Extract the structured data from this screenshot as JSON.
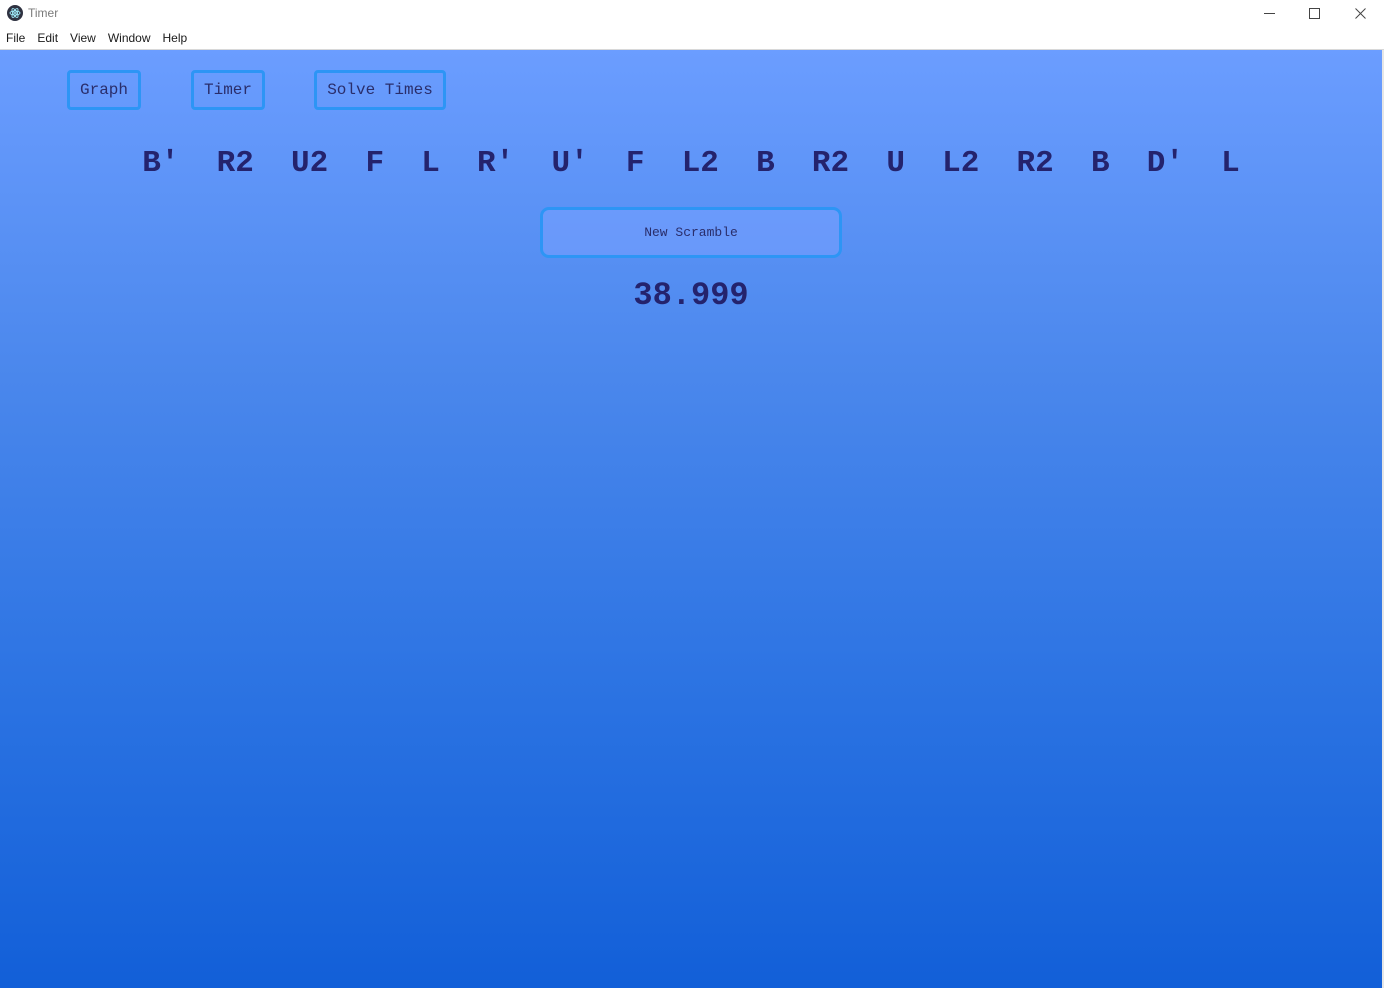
{
  "window": {
    "title": "Timer",
    "app_icon": "electron-atom-icon",
    "controls": [
      "minimize-icon",
      "maximize-icon",
      "close-icon"
    ]
  },
  "menubar": {
    "items": [
      "File",
      "Edit",
      "View",
      "Window",
      "Help"
    ]
  },
  "nav": {
    "graph_label": "Graph",
    "timer_label": "Timer",
    "solve_times_label": "Solve Times"
  },
  "scramble": {
    "text": "B'  R2  U2  F  L  R'  U'  F  L2  B  R2  U  L2  R2  B  D'  L"
  },
  "new_scramble_label": "New Scramble",
  "timer": {
    "value": "38.999"
  },
  "colors": {
    "accent_border": "#2d95f5",
    "text_dark": "#24236d",
    "bg_top": "#6b9dff",
    "bg_bottom": "#125fd8"
  }
}
